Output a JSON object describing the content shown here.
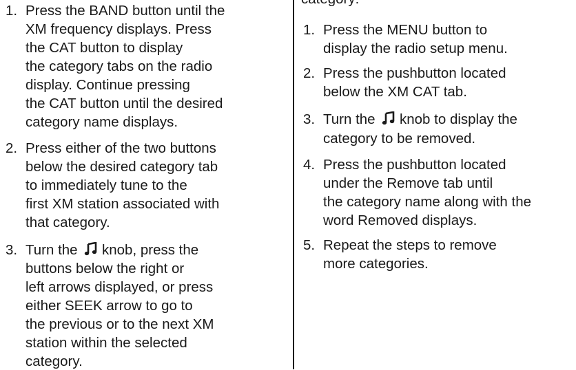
{
  "left": {
    "items": [
      {
        "number": "1.",
        "lines": [
          "Press the BAND button until the",
          "XM frequency displays. Press",
          "the CAT button to display",
          "the category tabs on the radio",
          "display. Continue pressing",
          "the CAT button until the desired",
          "category name displays."
        ]
      },
      {
        "number": "2.",
        "lines": [
          "Press either of the two buttons",
          "below the desired category tab",
          "to immediately tune to the",
          "first XM station associated with",
          "that category."
        ]
      },
      {
        "number": "3.",
        "first_prefix": "Turn the",
        "first_suffix": "knob, press the",
        "lines": [
          "buttons below the right or",
          "left arrows displayed, or press",
          "either SEEK arrow to go to",
          "the previous or to the next XM",
          "station within the selected",
          "category."
        ]
      }
    ]
  },
  "right": {
    "top_fragment": "category:",
    "items": [
      {
        "number": "1.",
        "lines": [
          "Press the MENU button to",
          "display the radio setup menu."
        ]
      },
      {
        "number": "2.",
        "lines": [
          "Press the pushbutton located",
          "below the XM CAT tab."
        ]
      },
      {
        "number": "3.",
        "first_prefix": "Turn the",
        "first_suffix": "knob to display the",
        "lines": [
          "category to be removed."
        ]
      },
      {
        "number": "4.",
        "lines": [
          "Press the pushbutton located",
          "under the Remove tab until",
          "the category name along with the",
          "word Removed displays."
        ]
      },
      {
        "number": "5.",
        "lines": [
          "Repeat the steps to remove",
          "more categories."
        ]
      }
    ]
  },
  "icons": {
    "knob": "music-note-icon"
  }
}
